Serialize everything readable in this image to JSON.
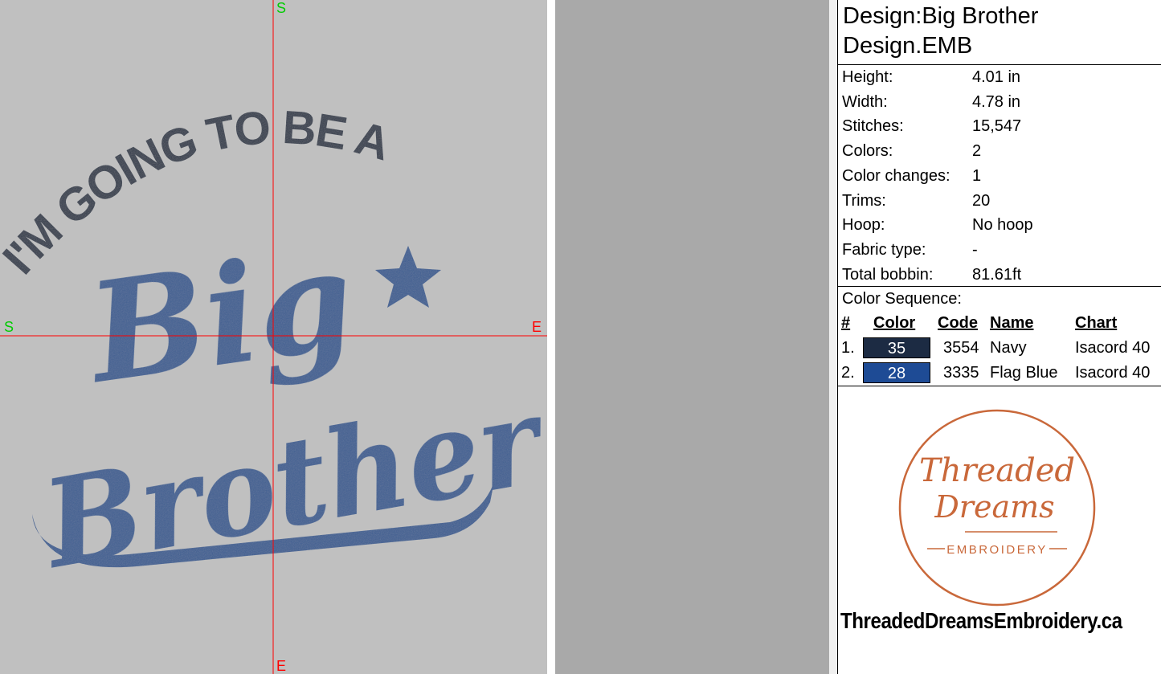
{
  "canvas": {
    "axis_labels": {
      "top": "S",
      "left": "S",
      "right": "E",
      "bottom": "E"
    },
    "design_text": {
      "arc_line": "I'M GOING TO BE A",
      "big": "Big",
      "brother": "Brother"
    },
    "colors": {
      "background": "#c0c0c0",
      "navy": "#353e4d",
      "blue": "#3e5f92",
      "crosshair": "#ff0000",
      "axis_start": "#00cc00",
      "axis_end": "#ff0000"
    }
  },
  "info": {
    "title_line1": "Design:Big Brother",
    "title_line2": "Design.EMB",
    "properties": [
      {
        "label": "Height:",
        "value": "4.01 in"
      },
      {
        "label": "Width:",
        "value": "4.78 in"
      },
      {
        "label": "Stitches:",
        "value": "15,547"
      },
      {
        "label": "Colors:",
        "value": "2"
      },
      {
        "label": "Color changes:",
        "value": "1"
      },
      {
        "label": "Trims:",
        "value": "20"
      },
      {
        "label": "Hoop:",
        "value": "No hoop"
      },
      {
        "label": "Fabric type:",
        "value": "-"
      },
      {
        "label": "Total bobbin:",
        "value": "81.61ft"
      }
    ],
    "color_sequence": {
      "title": "Color Sequence:",
      "headers": {
        "num": "#",
        "color": "Color",
        "code": "Code",
        "name": "Name",
        "chart": "Chart"
      },
      "rows": [
        {
          "num": "1.",
          "color": "35",
          "hex": "#1c2b43",
          "code": "3554",
          "name": "Navy",
          "chart": "Isacord 40"
        },
        {
          "num": "2.",
          "color": "28",
          "hex": "#1e4b95",
          "code": "3335",
          "name": "Flag Blue",
          "chart": "Isacord 40"
        }
      ]
    },
    "logo": {
      "line1": "Threaded",
      "line2": "Dreams",
      "line3": "EMBROIDERY",
      "color": "#c9683a"
    },
    "footer": "ThreadedDreamsEmbroidery.ca"
  }
}
